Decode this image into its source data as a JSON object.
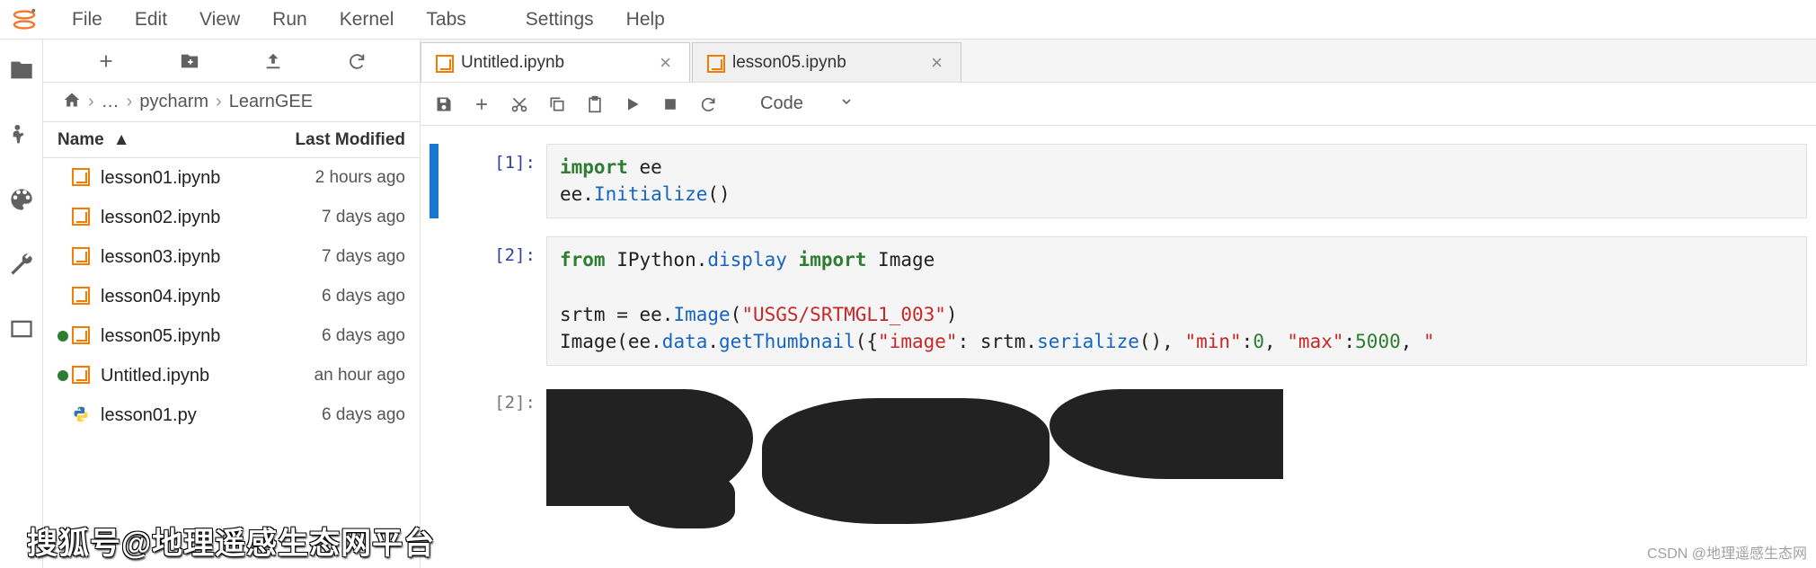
{
  "menu": {
    "items": [
      "File",
      "Edit",
      "View",
      "Run",
      "Kernel",
      "Tabs",
      "Settings",
      "Help"
    ]
  },
  "activity": {
    "icons": [
      "folder-icon",
      "running-icon",
      "palette-icon",
      "wrench-icon",
      "tabs-icon"
    ]
  },
  "file_toolbar": {
    "icons": [
      "new-launcher-icon",
      "new-folder-icon",
      "upload-icon",
      "refresh-icon"
    ]
  },
  "breadcrumb": {
    "home": "home-icon",
    "parts": [
      "…",
      "pycharm",
      "LearnGEE"
    ]
  },
  "file_header": {
    "name": "Name",
    "modified": "Last Modified"
  },
  "files": [
    {
      "name": "lesson01.ipynb",
      "mod": "2 hours ago",
      "type": "notebook",
      "running": false
    },
    {
      "name": "lesson02.ipynb",
      "mod": "7 days ago",
      "type": "notebook",
      "running": false
    },
    {
      "name": "lesson03.ipynb",
      "mod": "7 days ago",
      "type": "notebook",
      "running": false
    },
    {
      "name": "lesson04.ipynb",
      "mod": "6 days ago",
      "type": "notebook",
      "running": false
    },
    {
      "name": "lesson05.ipynb",
      "mod": "6 days ago",
      "type": "notebook",
      "running": true
    },
    {
      "name": "Untitled.ipynb",
      "mod": "an hour ago",
      "type": "notebook",
      "running": true
    },
    {
      "name": "lesson01.py",
      "mod": "6 days ago",
      "type": "python",
      "running": false
    }
  ],
  "tabs": [
    {
      "label": "Untitled.ipynb",
      "active": true,
      "icon": "notebook-icon"
    },
    {
      "label": "lesson05.ipynb",
      "active": false,
      "icon": "notebook-icon"
    }
  ],
  "nb_toolbar": {
    "icons": [
      "save-icon",
      "add-cell-icon",
      "cut-icon",
      "copy-icon",
      "paste-icon",
      "run-icon",
      "stop-icon",
      "restart-icon"
    ],
    "celltype": "Code"
  },
  "cells": [
    {
      "prompt": "[1]:",
      "code_html": "<span class='kw'>import</span> ee\nee.<span class='fn'>Initialize</span>()",
      "active": true
    },
    {
      "prompt": "[2]:",
      "code_html": "<span class='kw'>from</span> IPython.<span class='fn'>display</span> <span class='kw'>import</span> Image\n\nsrtm = ee.<span class='fn'>Image</span>(<span class='str'>\"USGS/SRTMGL1_003\"</span>)\nImage(ee.<span class='fn'>data</span>.<span class='fn'>getThumbnail</span>({<span class='str'>\"image\"</span>: srtm.<span class='fn'>serialize</span>(), <span class='str'>\"min\"</span>:<span class='num'>0</span>, <span class='str'>\"max\"</span>:<span class='num'>5000</span>, <span class='str'>\"",
      "active": false,
      "has_output": true,
      "output_prompt": "[2]:"
    }
  ],
  "watermarks": {
    "left": "搜狐号@地理遥感生态网平台",
    "right": "CSDN @地理遥感生态网"
  }
}
